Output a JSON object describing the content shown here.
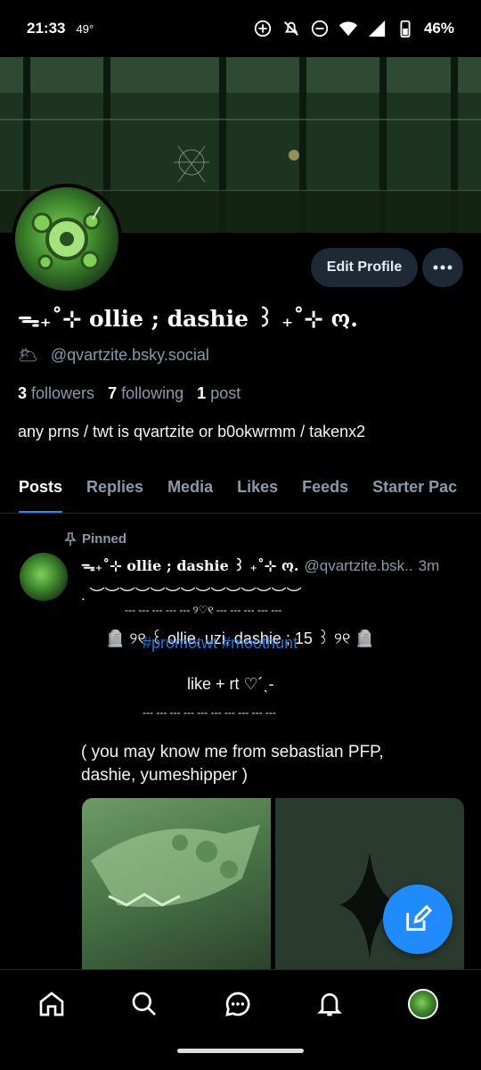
{
  "status_bar": {
    "time": "21:33",
    "temperature": "49°",
    "battery": "46%"
  },
  "profile": {
    "display_name": "ᯓ₊˚⊹ ollie ; dashie ꒱ ₊˚⊹ ო.",
    "handle_icon": "sun-emoji",
    "handle_emoji": "🌥",
    "handle": "@qvartzite.bsky.social",
    "followers_count": "3",
    "followers_label": "followers",
    "following_count": "7",
    "following_label": "following",
    "posts_count": "1",
    "posts_label": "post",
    "bio": "any prns / twt is qvartzite or b0okwrmm / takenx2",
    "edit_button": "Edit Profile"
  },
  "tabs": [
    "Posts",
    "Replies",
    "Media",
    "Likes",
    "Feeds",
    "Starter Pac"
  ],
  "post": {
    "pinned_label": "Pinned",
    "author_name": "ᯓ₊˚⊹ ollie ; dashie ꒱ ₊˚⊹ ო.",
    "author_handle": "@qvartzite.bsk..",
    "time": "3m",
    "line1": ".      ︶︶︶︶︶︶︶︶︶︶︶︶︶︶",
    "line2": "--- --- --- --- --- ୨♡୧ --- --- --- --- ---",
    "line3": "🪦 ୨୧ ꒰ ollie, uzi, dashie ; 15 ꒱ ୨୧ 🪦",
    "hashtags": "#promotwt #moothunt",
    "line4": "like + rt  ♡´ˎ-",
    "line5": "--- --- --- --- --- --- --- --- --- ---",
    "line6": "( you may know me from sebastian PFP,",
    "line7": "dashie, yumeshipper )"
  },
  "colors": {
    "accent": "#208bfe",
    "muted": "#8a99ab",
    "button_bg": "#1e2936"
  },
  "nav_icons": [
    "home-icon",
    "search-icon",
    "chat-icon",
    "bell-icon",
    "profile-avatar"
  ]
}
